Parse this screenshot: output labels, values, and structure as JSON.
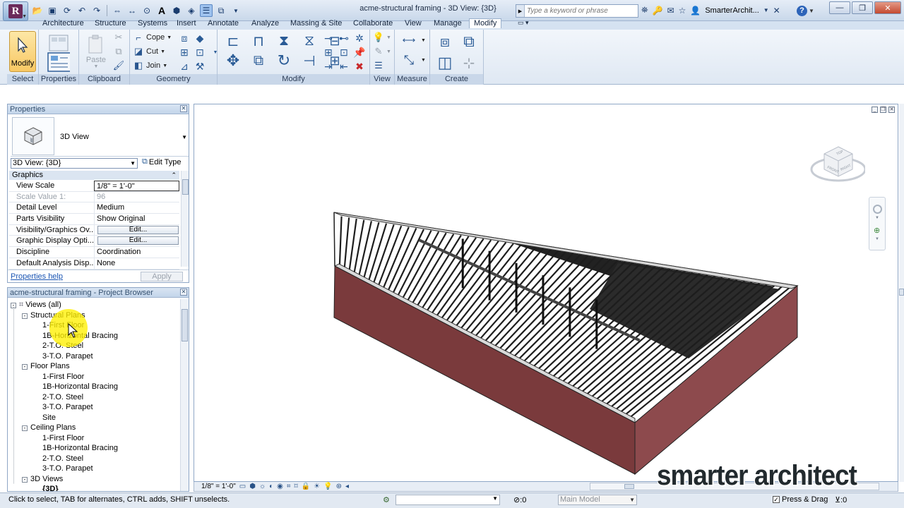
{
  "window": {
    "title": "acme-structural framing - 3D View: {3D}",
    "search_placeholder": "Type a keyword or phrase",
    "user": "SmarterArchit...",
    "help": "?"
  },
  "qat_icons": [
    "open-icon",
    "save-icon",
    "sync-icon",
    "undo-icon",
    "redo-icon",
    "measure-icon",
    "dimension-icon",
    "tag-icon",
    "text-icon",
    "3d-view-icon",
    "section-icon",
    "thin-lines-icon",
    "close-hidden-icon",
    "dropdown-icon"
  ],
  "ribbon_tabs": [
    "Architecture",
    "Structure",
    "Systems",
    "Insert",
    "Annotate",
    "Analyze",
    "Massing & Site",
    "Collaborate",
    "View",
    "Manage",
    "Modify"
  ],
  "active_tab": "Modify",
  "ribbon": {
    "modify_label": "Modify",
    "paste_label": "Paste",
    "cope_label": "Cope",
    "cut_label": "Cut",
    "join_label": "Join",
    "panels": {
      "select": "Select",
      "properties": "Properties",
      "clipboard": "Clipboard",
      "geometry": "Geometry",
      "modify": "Modify",
      "view": "View",
      "measure": "Measure",
      "create": "Create"
    }
  },
  "properties": {
    "title": "Properties",
    "type_name": "3D View",
    "view_selector": "3D View: {3D}",
    "edit_type": "Edit Type",
    "group": "Graphics",
    "rows": [
      {
        "key": "View Scale",
        "value": "1/8\" = 1'-0\""
      },
      {
        "key": "Scale Value    1:",
        "value": "96"
      },
      {
        "key": "Detail Level",
        "value": "Medium"
      },
      {
        "key": "Parts Visibility",
        "value": "Show Original"
      },
      {
        "key": "Visibility/Graphics Ov...",
        "value": "Edit..."
      },
      {
        "key": "Graphic Display Opti...",
        "value": "Edit..."
      },
      {
        "key": "Discipline",
        "value": "Coordination"
      },
      {
        "key": "Default Analysis Disp...",
        "value": "None"
      }
    ],
    "help_link": "Properties help",
    "apply": "Apply"
  },
  "browser": {
    "title": "acme-structural framing - Project Browser",
    "nodes": [
      {
        "label": "Views (all)",
        "level": 0,
        "toggle": "-"
      },
      {
        "label": "Structural Plans",
        "level": 1,
        "toggle": "-"
      },
      {
        "label": "1-First Floor",
        "level": 2
      },
      {
        "label": "1B-Horizontal Bracing",
        "level": 2
      },
      {
        "label": "2-T.O. Steel",
        "level": 2
      },
      {
        "label": "3-T.O. Parapet",
        "level": 2
      },
      {
        "label": "Floor Plans",
        "level": 1,
        "toggle": "-"
      },
      {
        "label": "1-First Floor",
        "level": 2
      },
      {
        "label": "1B-Horizontal Bracing",
        "level": 2
      },
      {
        "label": "2-T.O. Steel",
        "level": 2
      },
      {
        "label": "3-T.O. Parapet",
        "level": 2
      },
      {
        "label": "Site",
        "level": 2
      },
      {
        "label": "Ceiling Plans",
        "level": 1,
        "toggle": "-"
      },
      {
        "label": "1-First Floor",
        "level": 2
      },
      {
        "label": "1B-Horizontal Bracing",
        "level": 2
      },
      {
        "label": "2-T.O. Steel",
        "level": 2
      },
      {
        "label": "3-T.O. Parapet",
        "level": 2
      },
      {
        "label": "3D Views",
        "level": 1,
        "toggle": "-"
      },
      {
        "label": "{3D}",
        "level": 2,
        "bold": true
      }
    ]
  },
  "viewport": {
    "viewcube_faces": [
      "TOP",
      "FRONT",
      "RIGHT"
    ],
    "view_scale": "1/8\" = 1'-0\"",
    "colors": {
      "wall_front": "#7a3a3c",
      "wall_side": "#8d4a4d",
      "wall_top": "#d9d9d9",
      "joist": "#1d1d1d"
    }
  },
  "status": {
    "hint": "Click to select, TAB for alternates, CTRL adds, SHIFT unselects.",
    "count": ":0",
    "model": "Main Model",
    "press_drag": "Press & Drag",
    "filter": ":0"
  },
  "watermark": "smarter architect"
}
